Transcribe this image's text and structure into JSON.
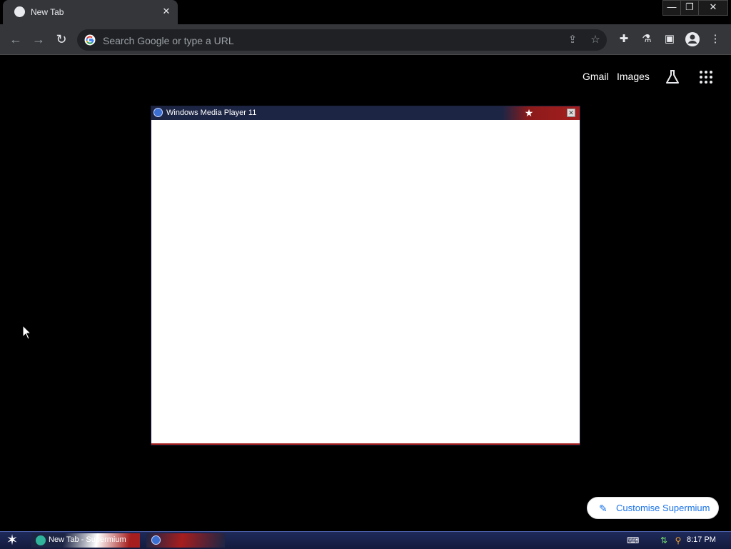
{
  "browser": {
    "tab_title": "New Tab",
    "omnibox_placeholder": "Search Google or type a URL"
  },
  "window_controls": {
    "minimize": "—",
    "restore": "❐",
    "close": "✕"
  },
  "page": {
    "links": [
      "Gmail",
      "Images"
    ],
    "customise_label": "Customise Supermium"
  },
  "wmp": {
    "title": "Windows Media Player 11"
  },
  "taskbar": {
    "item_label": "New Tab - Supermium",
    "clock": "8:17 PM"
  },
  "colors": {
    "tab_bg": "#35363a",
    "toolbar_bg": "#35363a",
    "omnibox_bg": "#202124",
    "accent_blue": "#1a73e8",
    "wmp_title_navy": "#1d2545",
    "wmp_title_red": "#a61e1e"
  },
  "icons": {
    "tab": "globe-icon",
    "back": "arrow-left-icon",
    "forward": "arrow-right-icon",
    "reload": "reload-icon",
    "share": "share-icon",
    "bookmark": "star-icon",
    "extensions": "puzzle-icon",
    "labs": "flask-icon",
    "side_panel": "side-panel-icon",
    "profile": "profile-icon",
    "menu": "kebab-menu-icon",
    "apps": "apps-grid-icon",
    "customise": "pencil-icon",
    "start": "star-icon"
  }
}
